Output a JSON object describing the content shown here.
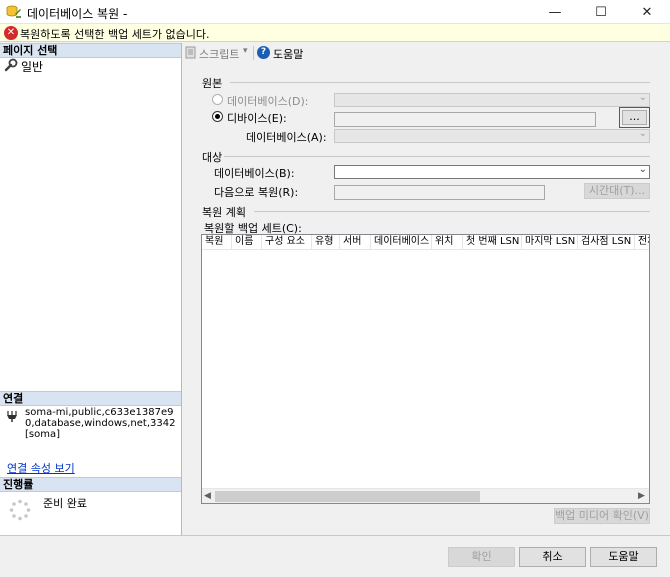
{
  "window": {
    "title": "데이터베이스 복원 -",
    "minimize": "—",
    "maximize": "☐",
    "close": "✕"
  },
  "banner": {
    "message": "복원하도록 선택한 백업 세트가 없습니다.",
    "icon": "error-icon"
  },
  "left": {
    "page_select_header": "페이지 선택",
    "pages": [
      {
        "label": "일반",
        "icon": "wrench-icon"
      }
    ],
    "connection_header": "연결",
    "connection_text": "soma-mi,public,c633e1387e90,database,windows,net,3342 [soma]",
    "connection_link": "연결 속성 보기",
    "progress_header": "진행률",
    "progress_text": "준비 완료"
  },
  "toolbar": {
    "script": "스크립트",
    "script_arrow": "▾",
    "help": "도움말",
    "help_glyph": "?"
  },
  "source": {
    "title": "원본",
    "database_radio": "데이터베이스(D):",
    "device_radio": "디바이스(E):",
    "browse_button": "...",
    "device_database_label": "데이터베이스(A):"
  },
  "target": {
    "title": "대상",
    "database_label": "데이터베이스(B):",
    "restore_to_label": "다음으로 복원(R):",
    "timeline_button": "시간대(T)..."
  },
  "plan": {
    "title": "복원 계획",
    "backup_sets_label": "복원할 백업 세트(C):",
    "columns": [
      "복원",
      "이름",
      "구성 요소",
      "유형",
      "서버",
      "데이터베이스",
      "위치",
      "첫 번째 LSN",
      "마지막 LSN",
      "검사점 LSN",
      "전체"
    ],
    "verify_button": "백업 미디어 확인(V)"
  },
  "footer": {
    "ok": "확인",
    "cancel": "취소",
    "help": "도움말"
  },
  "colors": {
    "banner_bg": "#ffffe1",
    "header_bg": "#d9e4f2",
    "link": "#0033cc",
    "browse_highlight": "#e02020"
  }
}
